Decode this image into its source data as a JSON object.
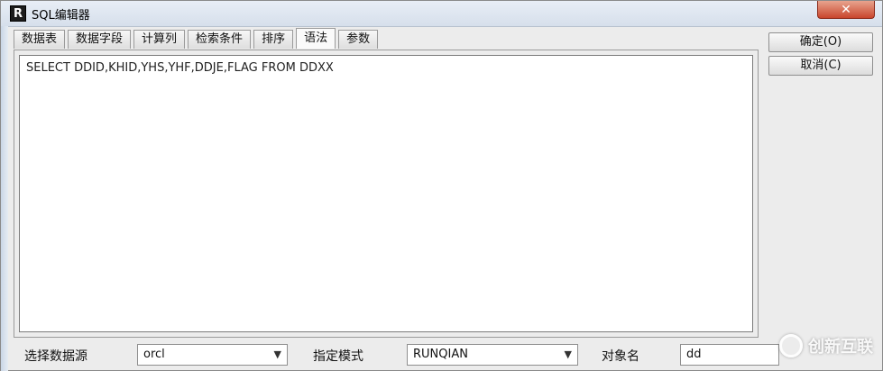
{
  "window": {
    "title": "SQL编辑器",
    "app_icon_glyph": "R",
    "close_glyph": "✕"
  },
  "tabs": [
    {
      "label": "数据表"
    },
    {
      "label": "数据字段"
    },
    {
      "label": "计算列"
    },
    {
      "label": "检索条件"
    },
    {
      "label": "排序"
    },
    {
      "label": "语法",
      "active": true
    },
    {
      "label": "参数"
    }
  ],
  "editor": {
    "sql": "SELECT DDID,KHID,YHS,YHF,DDJE,FLAG FROM DDXX"
  },
  "buttons": {
    "ok_label": "确定(O)",
    "cancel_label": "取消(C)"
  },
  "footer": {
    "datasource_label": "选择数据源",
    "datasource_value": "orcl",
    "schema_label": "指定模式",
    "schema_value": "RUNQIAN",
    "object_label": "对象名",
    "object_value": "dd"
  },
  "watermark": {
    "text": "创新互联"
  },
  "colors": {
    "close_button": "#c9462d",
    "window_bg": "#ececec"
  }
}
